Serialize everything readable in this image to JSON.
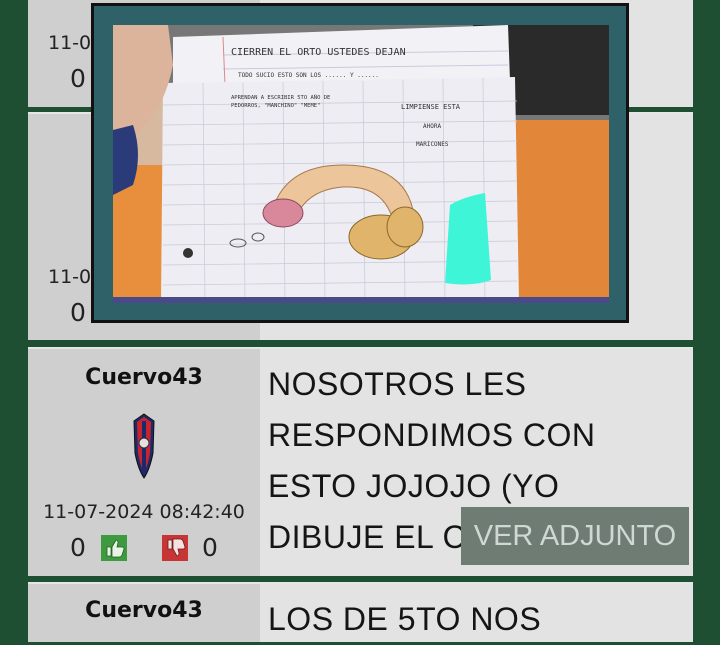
{
  "posts": [
    {
      "date_fragment": "11-0",
      "likes": "0"
    },
    {
      "date_fragment": "11-0",
      "likes": "0"
    },
    {
      "username": "Cuervo43",
      "date": "11-07-2024 08:42:40",
      "likes": "0",
      "dislikes": "0",
      "text": "NOSOTROS LES RESPONDIMOS CON ESTO JOJOJO (YO DIBUJE EL CHOTO)",
      "attachment_label": "VER ADJUNTO"
    },
    {
      "username": "Cuervo43",
      "text": "LOS DE 5TO NOS"
    }
  ],
  "attachment_image": {
    "note_line1": "CIERREN EL ORTO USTEDES DEJAN",
    "note_line2": "TODO SUCIO ESTO SON LOS ...... Y ......",
    "note_line3": "APRENDAN A ESCRIBIR 5TO AÑO DE",
    "note_line4": "PEDORROS, \"MANCHINO\" \"MEME\"",
    "note_right1": "LIMPIENSE ESTA",
    "note_right2": "AHORA",
    "note_right3": "MARICONES"
  },
  "colors": {
    "background": "#1f4f32",
    "like": "#3e9a3e",
    "dislike": "#c73535",
    "button": "#6f7c74",
    "modal_frame": "#2f6168"
  },
  "icons": [
    "thumbs-up-icon",
    "thumbs-down-icon",
    "team-badge-icon"
  ]
}
